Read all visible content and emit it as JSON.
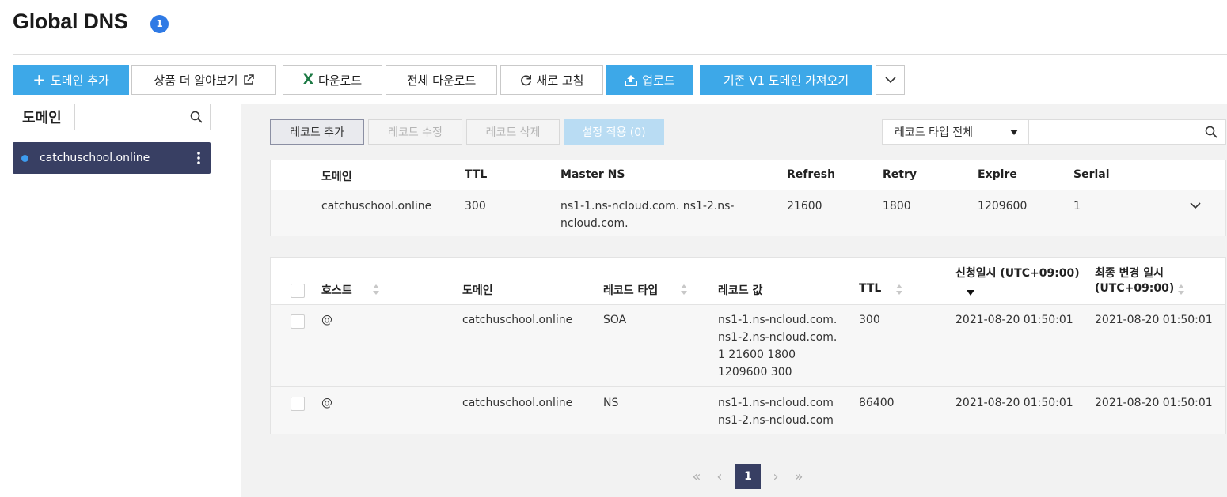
{
  "header": {
    "title": "Global DNS",
    "badge": "1"
  },
  "toolbar": {
    "add_domain": "도메인 추가",
    "learn_more": "상품 더 알아보기",
    "download": "다운로드",
    "download_all": "전체 다운로드",
    "refresh": "새로 고침",
    "upload": "업로드",
    "import_v1": "기존 V1 도메인 가져오기"
  },
  "sidebar": {
    "label": "도메인",
    "search_placeholder": "",
    "items": [
      {
        "label": "catchuschool.online"
      }
    ]
  },
  "record_actions": {
    "add": "레코드 추가",
    "edit": "레코드 수정",
    "delete": "레코드 삭제",
    "apply": "설정 적용 (0)"
  },
  "filter": {
    "type_selected": "레코드 타입 전체",
    "search_placeholder": ""
  },
  "soa_table": {
    "headers": {
      "domain": "도메인",
      "ttl": "TTL",
      "master_ns": "Master NS",
      "refresh": "Refresh",
      "retry": "Retry",
      "expire": "Expire",
      "serial": "Serial"
    },
    "row": {
      "domain": "catchuschool.online",
      "ttl": "300",
      "master_ns_1": "ns1-1.ns-ncloud.com. ns1-2.ns-",
      "master_ns_2": "ncloud.com.",
      "refresh": "21600",
      "retry": "1800",
      "expire": "1209600",
      "serial": "1"
    }
  },
  "records_table": {
    "headers": {
      "host": "호스트",
      "domain": "도메인",
      "type": "레코드 타입",
      "value": "레코드 값",
      "ttl": "TTL",
      "created_1": "신청일시 (UTC+09:00)",
      "modified_1": "최종 변경 일시",
      "modified_2": "(UTC+09:00)"
    },
    "rows": [
      {
        "host": "@",
        "domain": "catchuschool.online",
        "type": "SOA",
        "value": [
          "ns1-1.ns-ncloud.com.",
          "ns1-2.ns-ncloud.com.",
          "1 21600 1800",
          "1209600 300"
        ],
        "ttl": "300",
        "created": "2021-08-20 01:50:01",
        "modified": "2021-08-20 01:50:01"
      },
      {
        "host": "@",
        "domain": "catchuschool.online",
        "type": "NS",
        "value": [
          "ns1-1.ns-ncloud.com",
          "ns1-2.ns-ncloud.com"
        ],
        "ttl": "86400",
        "created": "2021-08-20 01:50:01",
        "modified": "2021-08-20 01:50:01"
      }
    ]
  },
  "pagination": {
    "current": "1"
  },
  "colors": {
    "primary": "#3da8e8",
    "nav_dark": "#383f63",
    "badge": "#2f7ae5",
    "excel_green": "#1d7a45"
  }
}
